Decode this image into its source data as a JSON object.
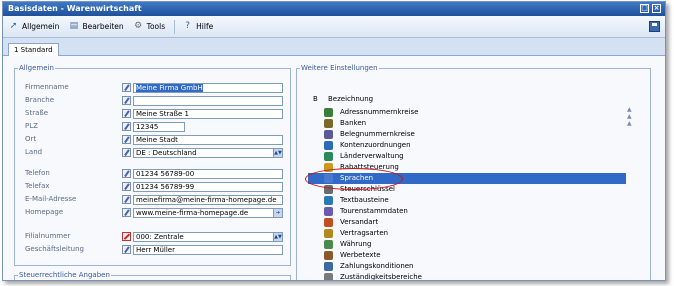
{
  "window": {
    "title": "Basisdaten - Warenwirtschaft"
  },
  "menu": {
    "items": [
      {
        "label": "Allgemein",
        "icon": "arrow-icon"
      },
      {
        "label": "Bearbeiten",
        "icon": "document-icon"
      },
      {
        "label": "Tools",
        "icon": "tools-icon"
      },
      {
        "label": "Hilfe",
        "icon": "help-icon"
      }
    ]
  },
  "tabs": [
    {
      "label": "1 Standard"
    }
  ],
  "allgemein": {
    "title": "Allgemein",
    "fields": [
      {
        "label": "Firmenname",
        "value": "Meine Firma GmbH"
      },
      {
        "label": "Branche",
        "value": ""
      },
      {
        "label": "Straße",
        "value": "Meine Straße 1"
      },
      {
        "label": "PLZ",
        "value": "12345"
      },
      {
        "label": "Ort",
        "value": "Meine Stadt"
      },
      {
        "label": "Land",
        "value": "DE   : Deutschland"
      },
      {
        "label": "Telefon",
        "value": "01234 56789-00"
      },
      {
        "label": "Telefax",
        "value": "01234 56789-99"
      },
      {
        "label": "E-Mail-Adresse",
        "value": "meinefirma@meine-firma-homepage.de"
      },
      {
        "label": "Homepage",
        "value": "www.meine-firma-homepage.de"
      },
      {
        "label": "Filialnummer",
        "value": "000: Zentrale"
      },
      {
        "label": "Geschäftsleitung",
        "value": "Herr Müller"
      }
    ]
  },
  "steuer": {
    "title": "Steuerrechtliche Angaben"
  },
  "weitere": {
    "title": "Weitere Einstellungen",
    "col_b": "B",
    "col_name": "Bezeichnung",
    "items": [
      {
        "label": "Adressnummernkreise",
        "color": "#3b7d3b"
      },
      {
        "label": "Banken",
        "color": "#7a6a2a"
      },
      {
        "label": "Belegnummernkreise",
        "color": "#5a5a9a"
      },
      {
        "label": "Kontenzuordnungen",
        "color": "#2a6ab8"
      },
      {
        "label": "Länderverwaltung",
        "color": "#2a8a5a"
      },
      {
        "label": "Rabattsteuerung",
        "color": "#c89a20"
      },
      {
        "label": "Sprachen",
        "color": "#4a7ad0"
      },
      {
        "label": "Steuerschlüssel",
        "color": "#6a6a6a"
      },
      {
        "label": "Textbausteine",
        "color": "#2a7ab8"
      },
      {
        "label": "Tourenstammdaten",
        "color": "#6a5ab0"
      },
      {
        "label": "Versandart",
        "color": "#c05020"
      },
      {
        "label": "Vertragsarten",
        "color": "#b08a20"
      },
      {
        "label": "Währung",
        "color": "#4a8a4a"
      },
      {
        "label": "Werbetexte",
        "color": "#8a5a2a"
      },
      {
        "label": "Zahlungskonditionen",
        "color": "#3a6aa0"
      },
      {
        "label": "Zuständigkeitsbereiche",
        "color": "#7a7a7a"
      }
    ],
    "selected": "Sprachen"
  }
}
